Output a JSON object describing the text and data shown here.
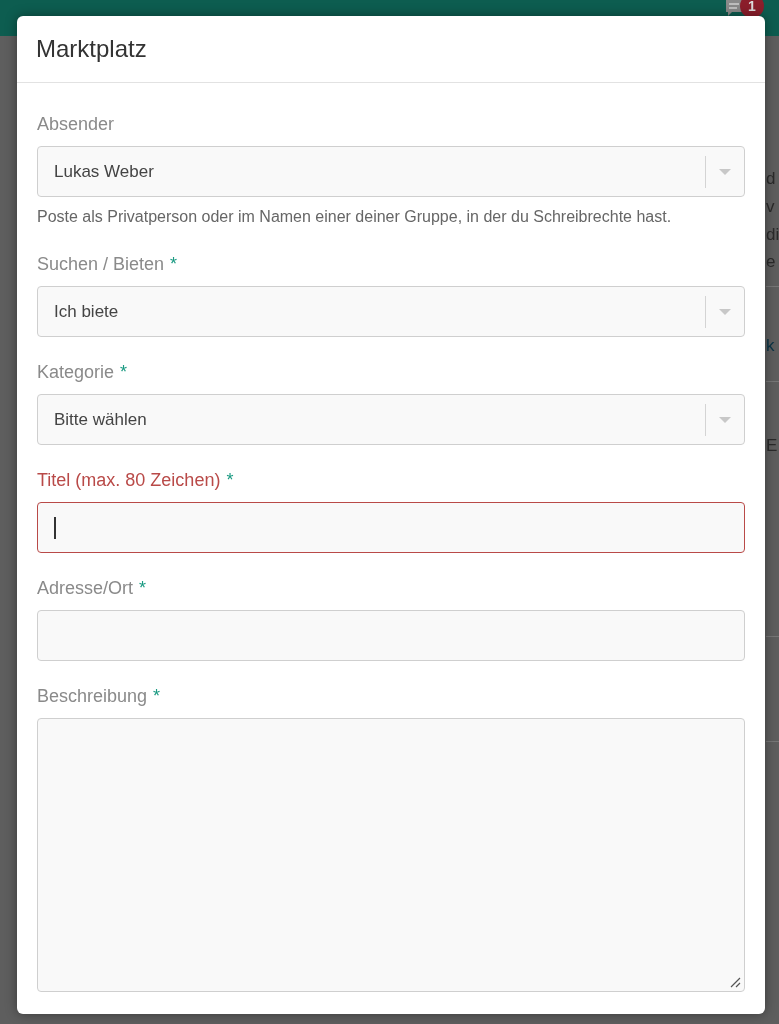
{
  "background": {
    "notification_badge": "1",
    "fragments": [
      {
        "text": "d",
        "kind": "text"
      },
      {
        "text": "v",
        "kind": "text"
      },
      {
        "text": "di",
        "kind": "text"
      },
      {
        "text": "e",
        "kind": "text"
      },
      {
        "text": "k",
        "kind": "link"
      },
      {
        "text": "E",
        "kind": "text"
      }
    ]
  },
  "modal": {
    "title": "Marktplatz",
    "fields": [
      {
        "kind": "select",
        "label": "Absender",
        "error": false,
        "value": "Lukas Weber",
        "help": "Poste als Privatperson oder im Namen einer deiner Gruppe, in der du Schreibrechte hast."
      },
      {
        "kind": "select",
        "label": "Suchen / Bieten",
        "required_mark": "*",
        "error": false,
        "value": "Ich biete"
      },
      {
        "kind": "select",
        "label": "Kategorie",
        "required_mark": "*",
        "error": false,
        "value": "Bitte wählen"
      },
      {
        "kind": "input",
        "label": "Titel (max. 80 Zeichen)",
        "required_mark": "*",
        "error": true,
        "focused": true
      },
      {
        "kind": "input",
        "label": "Adresse/Ort",
        "required_mark": "*",
        "error": false,
        "focused": false
      },
      {
        "kind": "textarea",
        "label": "Beschreibung",
        "required_mark": "*",
        "error": false
      }
    ]
  }
}
